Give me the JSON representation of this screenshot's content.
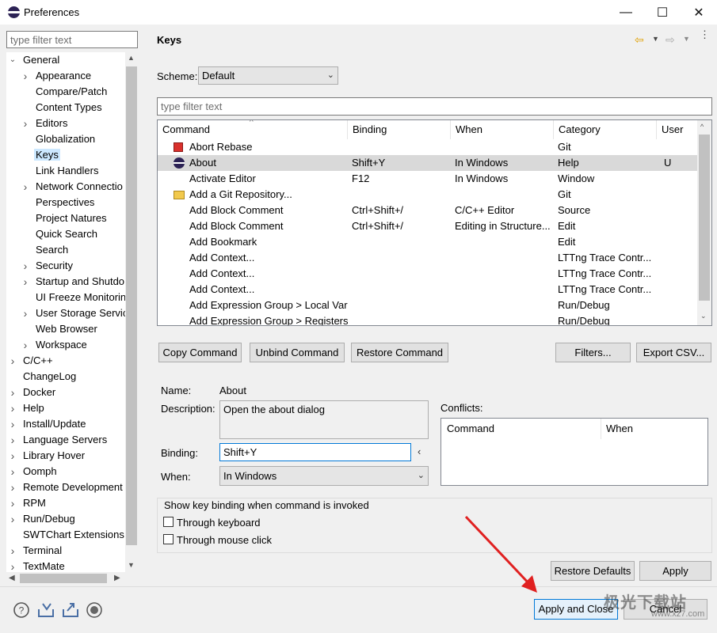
{
  "window": {
    "title": "Preferences",
    "min": "—",
    "max": "☐",
    "close": "✕"
  },
  "nav": {
    "filter_placeholder": "type filter text",
    "items": [
      {
        "label": "General",
        "level": 0,
        "state": "open"
      },
      {
        "label": "Appearance",
        "level": 1,
        "state": "closed"
      },
      {
        "label": "Compare/Patch",
        "level": 1,
        "state": "leaf"
      },
      {
        "label": "Content Types",
        "level": 1,
        "state": "leaf"
      },
      {
        "label": "Editors",
        "level": 1,
        "state": "closed"
      },
      {
        "label": "Globalization",
        "level": 1,
        "state": "leaf"
      },
      {
        "label": "Keys",
        "level": 1,
        "state": "leaf",
        "selected": true
      },
      {
        "label": "Link Handlers",
        "level": 1,
        "state": "leaf"
      },
      {
        "label": "Network Connectio",
        "level": 1,
        "state": "closed"
      },
      {
        "label": "Perspectives",
        "level": 1,
        "state": "leaf"
      },
      {
        "label": "Project Natures",
        "level": 1,
        "state": "leaf"
      },
      {
        "label": "Quick Search",
        "level": 1,
        "state": "leaf"
      },
      {
        "label": "Search",
        "level": 1,
        "state": "leaf"
      },
      {
        "label": "Security",
        "level": 1,
        "state": "closed"
      },
      {
        "label": "Startup and Shutdo",
        "level": 1,
        "state": "closed"
      },
      {
        "label": "UI Freeze Monitorin",
        "level": 1,
        "state": "leaf"
      },
      {
        "label": "User Storage Servic",
        "level": 1,
        "state": "closed"
      },
      {
        "label": "Web Browser",
        "level": 1,
        "state": "leaf"
      },
      {
        "label": "Workspace",
        "level": 1,
        "state": "closed"
      },
      {
        "label": "C/C++",
        "level": 0,
        "state": "closed"
      },
      {
        "label": "ChangeLog",
        "level": 0,
        "state": "leaf"
      },
      {
        "label": "Docker",
        "level": 0,
        "state": "closed"
      },
      {
        "label": "Help",
        "level": 0,
        "state": "closed"
      },
      {
        "label": "Install/Update",
        "level": 0,
        "state": "closed"
      },
      {
        "label": "Language Servers",
        "level": 0,
        "state": "closed"
      },
      {
        "label": "Library Hover",
        "level": 0,
        "state": "closed"
      },
      {
        "label": "Oomph",
        "level": 0,
        "state": "closed"
      },
      {
        "label": "Remote Development",
        "level": 0,
        "state": "closed"
      },
      {
        "label": "RPM",
        "level": 0,
        "state": "closed"
      },
      {
        "label": "Run/Debug",
        "level": 0,
        "state": "closed"
      },
      {
        "label": "SWTChart Extensions",
        "level": 0,
        "state": "leaf"
      },
      {
        "label": "Terminal",
        "level": 0,
        "state": "closed"
      },
      {
        "label": "TextMate",
        "level": 0,
        "state": "closed"
      }
    ]
  },
  "page": {
    "title": "Keys",
    "scheme_label": "Scheme:",
    "scheme_value": "Default",
    "filter_placeholder": "type filter text",
    "columns": [
      "Command",
      "Binding",
      "When",
      "Category",
      "User"
    ],
    "rows": [
      {
        "icon": "red-square",
        "command": "Abort Rebase",
        "binding": "",
        "when": "",
        "category": "Git",
        "user": ""
      },
      {
        "icon": "eclipse",
        "command": "About",
        "binding": "Shift+Y",
        "when": "In Windows",
        "category": "Help",
        "user": "U",
        "selected": true
      },
      {
        "icon": "",
        "command": "Activate Editor",
        "binding": "F12",
        "when": "In Windows",
        "category": "Window",
        "user": ""
      },
      {
        "icon": "git-folder",
        "command": "Add a Git Repository...",
        "binding": "",
        "when": "",
        "category": "Git",
        "user": ""
      },
      {
        "icon": "",
        "command": "Add Block Comment",
        "binding": "Ctrl+Shift+/",
        "when": "C/C++ Editor",
        "category": "Source",
        "user": ""
      },
      {
        "icon": "",
        "command": "Add Block Comment",
        "binding": "Ctrl+Shift+/",
        "when": "Editing in Structure...",
        "category": "Edit",
        "user": ""
      },
      {
        "icon": "",
        "command": "Add Bookmark",
        "binding": "",
        "when": "",
        "category": "Edit",
        "user": ""
      },
      {
        "icon": "",
        "command": "Add Context...",
        "binding": "",
        "when": "",
        "category": "LTTng Trace Contr...",
        "user": ""
      },
      {
        "icon": "",
        "command": "Add Context...",
        "binding": "",
        "when": "",
        "category": "LTTng Trace Contr...",
        "user": ""
      },
      {
        "icon": "",
        "command": "Add Context...",
        "binding": "",
        "when": "",
        "category": "LTTng Trace Contr...",
        "user": ""
      },
      {
        "icon": "",
        "command": "Add Expression Group > Local Var",
        "binding": "",
        "when": "",
        "category": "Run/Debug",
        "user": ""
      },
      {
        "icon": "",
        "command": "Add Expression Group > Registers",
        "binding": "",
        "when": "",
        "category": "Run/Debug",
        "user": ""
      }
    ],
    "buttons": {
      "copy": "Copy Command",
      "unbind": "Unbind Command",
      "restore": "Restore Command",
      "filters": "Filters...",
      "export": "Export CSV..."
    },
    "detail": {
      "name_label": "Name:",
      "name_value": "About",
      "desc_label": "Description:",
      "desc_value": "Open the about dialog",
      "binding_label": "Binding:",
      "binding_value": "Shift+Y",
      "when_label": "When:",
      "when_value": "In Windows",
      "conflicts_label": "Conflicts:",
      "conflict_cols": [
        "Command",
        "When"
      ]
    },
    "show_group": {
      "title": "Show key binding when command is invoked",
      "keyboard": "Through keyboard",
      "mouse": "Through mouse click"
    },
    "restore_defaults": "Restore Defaults",
    "apply": "Apply"
  },
  "footer": {
    "apply_close": "Apply and Close",
    "cancel": "Cancel",
    "watermark": "极光下载站",
    "watermark_sub": "www.xz7.com"
  },
  "colors": {
    "selection": "#cce8ff",
    "arrow": "#e02020",
    "focus": "#0078d7"
  }
}
